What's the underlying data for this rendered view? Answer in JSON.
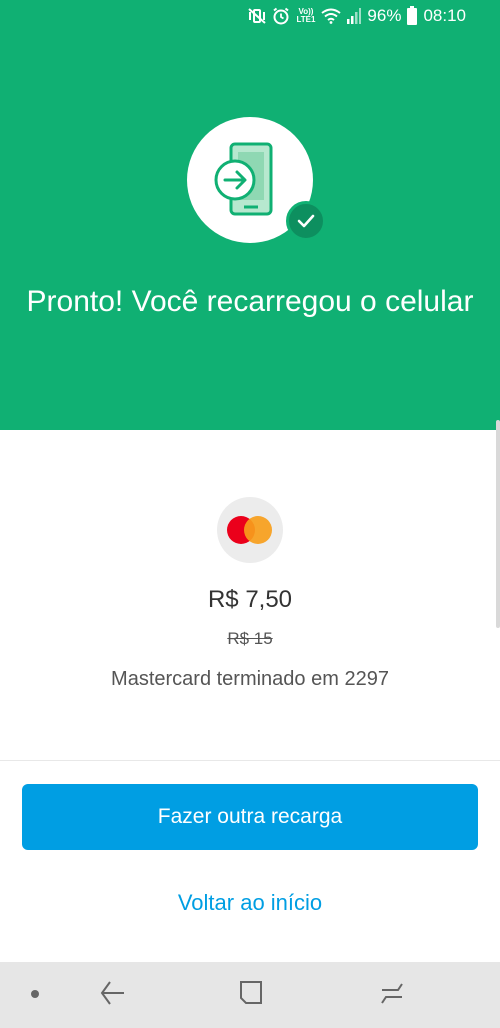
{
  "status_bar": {
    "lte_top": "Vo))",
    "lte_bottom": "LTE1",
    "battery": "96%",
    "time": "08:10"
  },
  "success": {
    "title": "Pronto! Você recarregou o celular"
  },
  "payment": {
    "amount": "R$ 7,50",
    "original_amount": "R$ 15",
    "card_description": "Mastercard terminado em 2297"
  },
  "actions": {
    "primary_label": "Fazer outra recarga",
    "secondary_label": "Voltar ao início"
  },
  "colors": {
    "header_green": "#10b073",
    "badge_green": "#0d8f5f",
    "accent_blue": "#009ee3"
  }
}
